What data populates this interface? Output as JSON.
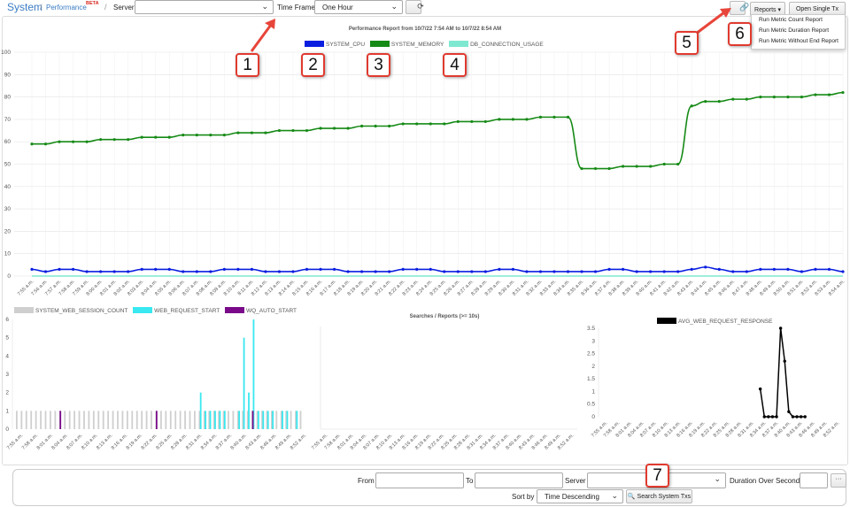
{
  "breadcrumb": {
    "root": "System",
    "page": "Performance",
    "page_badge": "BETA"
  },
  "toolbar": {
    "server_label": "Server",
    "server_value": "",
    "timeframe_label": "Time Frame",
    "timeframe_value": "One Hour",
    "refresh_icon": "refresh-icon",
    "link_icon": "link-icon",
    "reports_label": "Reports ▾",
    "open_single_tx_label": "Open Single Tx"
  },
  "reports_menu": {
    "items": [
      "Run Metric Count Report",
      "Run Metric Duration Report",
      "Run Metric Without End Report"
    ]
  },
  "callouts": [
    "1",
    "2",
    "3",
    "4",
    "5",
    "6",
    "7"
  ],
  "colors": {
    "cpu": "#0a1ee0",
    "memory": "#168a16",
    "db": "#7fe8d0",
    "session": "#cfcfcf",
    "web_request": "#39e8f0",
    "auto_start": "#7a0a8a",
    "avg_response": "#000000",
    "callout_border": "#e03a2f",
    "arrow": "#e8453a",
    "link": "#3a7cc4"
  },
  "filters": {
    "from_label": "From",
    "to_label": "To",
    "server_label": "Server",
    "duration_label": "Duration Over Seconds",
    "more_label": "···",
    "sort_label": "Sort by",
    "sort_value": "Time Descending",
    "search_button": "Search System Txs",
    "search_icon": "search-icon"
  },
  "chart_data": [
    {
      "type": "line",
      "title": "Performance Report from 10/7/22 7:54 AM to 10/7/22 8:54 AM",
      "x": [
        "7:55 a.m.",
        "7:56 a.m.",
        "7:57 a.m.",
        "7:58 a.m.",
        "7:59 a.m.",
        "8:00 a.m.",
        "8:01 a.m.",
        "8:02 a.m.",
        "8:03 a.m.",
        "8:04 a.m.",
        "8:05 a.m.",
        "8:06 a.m.",
        "8:07 a.m.",
        "8:08 a.m.",
        "8:09 a.m.",
        "8:10 a.m.",
        "8:11 a.m.",
        "8:12 a.m.",
        "8:13 a.m.",
        "8:14 a.m.",
        "8:15 a.m.",
        "8:16 a.m.",
        "8:17 a.m.",
        "8:18 a.m.",
        "8:19 a.m.",
        "8:20 a.m.",
        "8:21 a.m.",
        "8:22 a.m.",
        "8:23 a.m.",
        "8:24 a.m.",
        "8:25 a.m.",
        "8:26 a.m.",
        "8:27 a.m.",
        "8:28 a.m.",
        "8:29 a.m.",
        "8:30 a.m.",
        "8:31 a.m.",
        "8:32 a.m.",
        "8:33 a.m.",
        "8:34 a.m.",
        "8:35 a.m.",
        "8:36 a.m.",
        "8:37 a.m.",
        "8:38 a.m.",
        "8:39 a.m.",
        "8:40 a.m.",
        "8:41 a.m.",
        "8:42 a.m.",
        "8:43 a.m.",
        "8:44 a.m.",
        "8:45 a.m.",
        "8:46 a.m.",
        "8:47 a.m.",
        "8:48 a.m.",
        "8:49 a.m.",
        "8:50 a.m.",
        "8:51 a.m.",
        "8:52 a.m.",
        "8:53 a.m.",
        "8:54 a.m."
      ],
      "series": [
        {
          "name": "SYSTEM_CPU",
          "values": [
            3,
            2,
            3,
            3,
            2,
            2,
            2,
            2,
            3,
            3,
            3,
            2,
            2,
            2,
            3,
            3,
            3,
            2,
            2,
            2,
            3,
            3,
            3,
            2,
            2,
            2,
            2,
            3,
            3,
            3,
            2,
            2,
            2,
            2,
            3,
            3,
            2,
            2,
            2,
            2,
            2,
            2,
            3,
            3,
            2,
            2,
            2,
            2,
            3,
            4,
            3,
            2,
            2,
            3,
            3,
            3,
            2,
            3,
            3,
            2
          ]
        },
        {
          "name": "SYSTEM_MEMORY",
          "values": [
            59,
            59,
            60,
            60,
            60,
            61,
            61,
            61,
            62,
            62,
            62,
            63,
            63,
            63,
            63,
            64,
            64,
            64,
            65,
            65,
            65,
            66,
            66,
            66,
            67,
            67,
            67,
            68,
            68,
            68,
            68,
            69,
            69,
            69,
            70,
            70,
            70,
            71,
            71,
            71,
            48,
            48,
            48,
            49,
            49,
            49,
            50,
            50,
            76,
            78,
            78,
            79,
            79,
            80,
            80,
            80,
            80,
            81,
            81,
            82
          ]
        },
        {
          "name": "DB_CONNECTION_USAGE",
          "values": [
            0,
            0,
            0,
            0,
            0,
            0,
            0,
            0,
            0,
            0,
            0,
            0,
            0,
            0,
            0,
            0,
            0,
            0,
            0,
            0,
            0,
            0,
            0,
            0,
            0,
            0,
            0,
            0,
            0,
            0,
            0,
            0,
            0,
            0,
            0,
            0,
            0,
            0,
            0,
            0,
            0,
            0,
            0,
            0,
            0,
            0,
            0,
            0,
            0,
            0,
            0,
            0,
            0,
            0,
            0,
            0,
            0,
            0,
            0,
            0
          ]
        }
      ],
      "ylim": [
        0,
        100
      ],
      "yticks": [
        0,
        10,
        20,
        30,
        40,
        50,
        60,
        70,
        80,
        90,
        100
      ],
      "legend": "top",
      "grid": true
    },
    {
      "type": "bar",
      "title": "",
      "x": [
        "7:55 a.m.",
        "7:58 a.m.",
        "8:01 a.m.",
        "8:04 a.m.",
        "8:07 a.m.",
        "8:10 a.m.",
        "8:13 a.m.",
        "8:16 a.m.",
        "8:19 a.m.",
        "8:22 a.m.",
        "8:25 a.m.",
        "8:28 a.m.",
        "8:31 a.m.",
        "8:34 a.m.",
        "8:37 a.m.",
        "8:40 a.m.",
        "8:43 a.m.",
        "8:46 a.m.",
        "8:49 a.m.",
        "8:52 a.m."
      ],
      "series": [
        {
          "name": "SYSTEM_WEB_SESSION_COUNT",
          "values": [
            1,
            1,
            1,
            1,
            1,
            1,
            1,
            1,
            1,
            1,
            1,
            1,
            1,
            1,
            1,
            1,
            1,
            1,
            1,
            1,
            1,
            1,
            1,
            1,
            1,
            1,
            1,
            1,
            1,
            1,
            1,
            1,
            1,
            1,
            1,
            1,
            1,
            1,
            1,
            1,
            1,
            1,
            1,
            1,
            1,
            1,
            1,
            1,
            1,
            1,
            1,
            1,
            1,
            1,
            1,
            1,
            1,
            1,
            1,
            1
          ]
        },
        {
          "name": "WEB_REQUEST_START",
          "values": [
            0,
            0,
            0,
            0,
            0,
            0,
            0,
            0,
            0,
            0,
            0,
            0,
            0,
            0,
            0,
            0,
            0,
            0,
            0,
            0,
            0,
            0,
            0,
            0,
            0,
            0,
            0,
            0,
            0,
            0,
            0,
            0,
            0,
            0,
            0,
            0,
            0,
            0,
            2,
            1,
            1,
            1,
            1,
            1,
            0,
            0,
            1,
            5,
            2,
            6,
            1,
            1,
            1,
            1,
            0,
            1,
            1,
            0,
            1,
            0
          ]
        },
        {
          "name": "WQ_AUTO_START",
          "values": [
            0,
            0,
            0,
            0,
            0,
            0,
            0,
            0,
            0,
            1,
            0,
            0,
            0,
            0,
            0,
            0,
            0,
            0,
            0,
            0,
            0,
            0,
            0,
            0,
            0,
            0,
            0,
            0,
            0,
            1,
            0,
            0,
            0,
            0,
            0,
            0,
            0,
            0,
            0,
            0,
            0,
            0,
            0,
            0,
            0,
            0,
            0,
            0,
            0,
            1,
            0,
            0,
            0,
            0,
            0,
            0,
            0,
            0,
            0,
            0
          ]
        }
      ],
      "ylim": [
        0,
        6
      ],
      "yticks": [
        0,
        1,
        2,
        3,
        4,
        5,
        6
      ],
      "legend": "top",
      "grid": false
    },
    {
      "type": "line",
      "title": "Searches / Reports (>= 10s)",
      "x": [
        "7:55 a.m.",
        "7:58 a.m.",
        "8:01 a.m.",
        "8:04 a.m.",
        "8:07 a.m.",
        "8:10 a.m.",
        "8:13 a.m.",
        "8:16 a.m.",
        "8:19 a.m.",
        "8:22 a.m.",
        "8:25 a.m.",
        "8:28 a.m.",
        "8:31 a.m.",
        "8:34 a.m.",
        "8:37 a.m.",
        "8:40 a.m.",
        "8:43 a.m.",
        "8:46 a.m.",
        "8:49 a.m.",
        "8:52 a.m."
      ],
      "series": [],
      "legend": "none",
      "grid": false
    },
    {
      "type": "line",
      "title": "",
      "x": [
        "7:55 a.m.",
        "7:58 a.m.",
        "8:01 a.m.",
        "8:04 a.m.",
        "8:07 a.m.",
        "8:10 a.m.",
        "8:13 a.m.",
        "8:16 a.m.",
        "8:19 a.m.",
        "8:22 a.m.",
        "8:25 a.m.",
        "8:28 a.m.",
        "8:31 a.m.",
        "8:34 a.m.",
        "8:37 a.m.",
        "8:40 a.m.",
        "8:43 a.m.",
        "8:46 a.m.",
        "8:49 a.m.",
        "8:52 a.m."
      ],
      "series": [
        {
          "name": "AVG_WEB_REQUEST_RESPONSE",
          "points": [
            {
              "x": "8:33 a.m.",
              "y": 1.1
            },
            {
              "x": "8:34 a.m.",
              "y": 0
            },
            {
              "x": "8:35 a.m.",
              "y": 0
            },
            {
              "x": "8:36 a.m.",
              "y": 0
            },
            {
              "x": "8:37 a.m.",
              "y": 0
            },
            {
              "x": "8:38 a.m.",
              "y": 3.5
            },
            {
              "x": "8:39 a.m.",
              "y": 2.2
            },
            {
              "x": "8:40 a.m.",
              "y": 0.2
            },
            {
              "x": "8:41 a.m.",
              "y": 0
            },
            {
              "x": "8:42 a.m.",
              "y": 0
            },
            {
              "x": "8:43 a.m.",
              "y": 0
            },
            {
              "x": "8:44 a.m.",
              "y": 0
            }
          ]
        }
      ],
      "ylim": [
        0,
        3.5
      ],
      "yticks": [
        0,
        0.5,
        1,
        1.5,
        2,
        2.5,
        3,
        3.5
      ],
      "legend": "top",
      "grid": false
    }
  ]
}
